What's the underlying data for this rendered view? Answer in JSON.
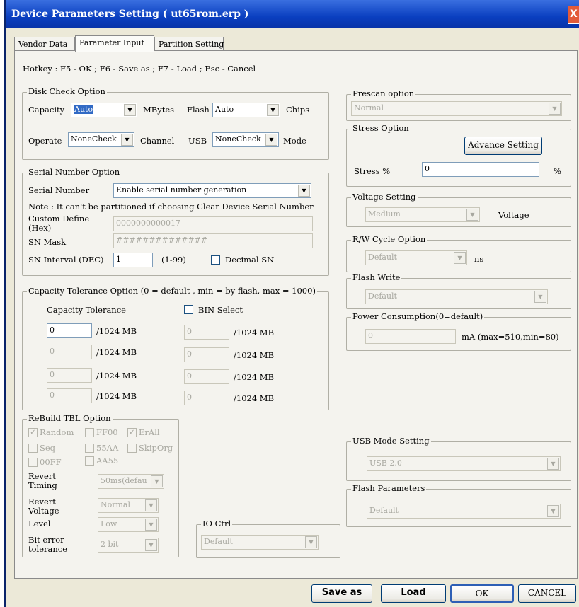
{
  "window": {
    "title": "Device Parameters Setting ( ut65rom.erp )",
    "close": "X"
  },
  "tabs": [
    "Vendor Data",
    "Parameter Input",
    "Partition Setting"
  ],
  "hotkey": "Hotkey : F5 - OK ; F6 - Save as ; F7 - Load ; Esc - Cancel",
  "disk_check": {
    "title": "Disk Check Option",
    "capacity_label": "Capacity",
    "capacity_value": "Auto",
    "mbytes": "MBytes",
    "flash_label": "Flash",
    "flash_value": "Auto",
    "chips": "Chips",
    "operate_label": "Operate",
    "operate_value": "NoneCheck",
    "channel": "Channel",
    "usb_label": "USB",
    "usb_value": "NoneCheck",
    "mode": "Mode"
  },
  "serial": {
    "title": "Serial Number Option",
    "sn_label": "Serial Number",
    "sn_value": "Enable serial number generation",
    "note": "Note : It can't be partitioned if choosing Clear Device Serial Number",
    "custom_label": "Custom Define",
    "custom_label2": "(Hex)",
    "custom_value": "0000000000017",
    "mask_label": "SN Mask",
    "mask_value": "##############",
    "interval_label": "SN Interval (DEC)",
    "interval_value": "1",
    "interval_range": "(1-99)",
    "decimal_label": "Decimal SN"
  },
  "capacity": {
    "title": "Capacity Tolerance Option (0 = default , min = by flash, max = 1000)",
    "tol_label": "Capacity Tolerance",
    "bin_label": "BIN Select",
    "unit": "/1024 MB",
    "left_values": [
      "0",
      "0",
      "0",
      "0"
    ],
    "right_values": [
      "0",
      "0",
      "0",
      "0"
    ]
  },
  "rebuild": {
    "title": "ReBuild TBL Option",
    "checks": [
      "Random",
      "FF00",
      "ErAll",
      "Seq",
      "55AA",
      "SkipOrg",
      "00FF",
      "AA55"
    ],
    "revert_timing_label": "Revert",
    "revert_timing_label2": "Timing",
    "revert_timing_value": "50ms(defau",
    "revert_voltage_label": "Revert",
    "revert_voltage_label2": "Voltage",
    "revert_voltage_value": "Normal",
    "level_label": "Level",
    "level_value": "Low",
    "bit_error_label": "Bit error",
    "bit_error_label2": "tolerance",
    "bit_error_value": "2 bit"
  },
  "io_ctrl": {
    "title": "IO Ctrl",
    "value": "Default"
  },
  "prescan": {
    "title": "Prescan option",
    "value": "Normal"
  },
  "stress": {
    "title": "Stress Option",
    "advance": "Advance Setting",
    "stress_label": "Stress %",
    "stress_value": "0",
    "pct": "%"
  },
  "voltage": {
    "title": "Voltage Setting",
    "value": "Medium",
    "unit": "Voltage"
  },
  "rw_cycle": {
    "title": "R/W Cycle Option",
    "value": "Default",
    "unit": "ns"
  },
  "flash_write": {
    "title": "Flash Write",
    "value": "Default"
  },
  "power": {
    "title": "Power Consumption(0=default)",
    "value": "0",
    "unit": "mA (max=510,min=80)"
  },
  "usb_mode": {
    "title": "USB Mode Setting",
    "value": "USB 2.0"
  },
  "flash_params": {
    "title": "Flash Parameters",
    "value": "Default"
  },
  "buttons": {
    "save_as": "Save as",
    "load": "Load",
    "ok": "OK",
    "cancel": "CANCEL"
  },
  "colors": {
    "title_bar": "#0a3fc0",
    "face": "#f4f3ee",
    "selection": "#316ac5"
  }
}
